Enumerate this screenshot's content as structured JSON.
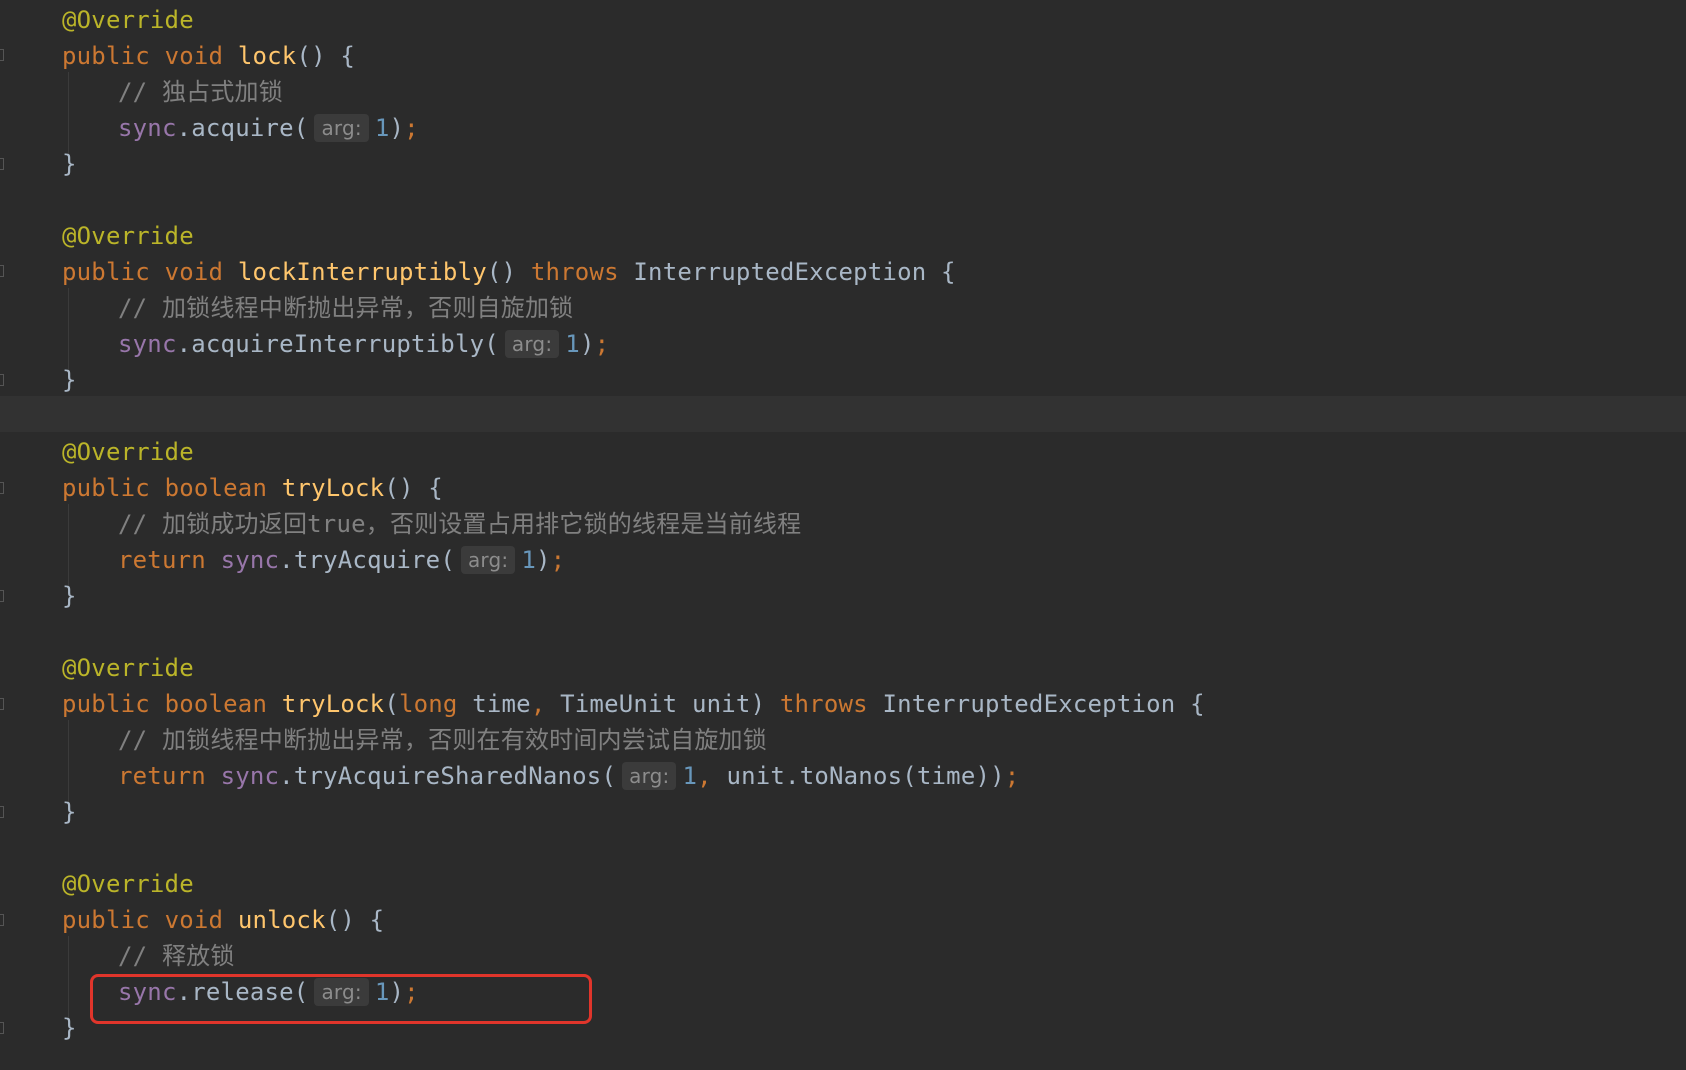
{
  "editor": {
    "methods": [
      {
        "annotation": "@Override",
        "signature": {
          "public": "public",
          "type": "void",
          "name": "lock",
          "params_open": "() {"
        },
        "comment": "// 独占式加锁",
        "body": {
          "field": "sync",
          "call": ".acquire(",
          "hint": "arg:",
          "arg": "1",
          "close": ")",
          "semi": ";"
        },
        "close": "}"
      },
      {
        "annotation": "@Override",
        "signature": {
          "public": "public",
          "type": "void",
          "name": "lockInterruptibly",
          "params_open": "() ",
          "throws": "throws",
          "exception": "InterruptedException {"
        },
        "comment": "// 加锁线程中断抛出异常，否则自旋加锁",
        "body": {
          "field": "sync",
          "call": ".acquireInterruptibly(",
          "hint": "arg:",
          "arg": "1",
          "close": ")",
          "semi": ";"
        },
        "close": "}"
      },
      {
        "annotation": "@Override",
        "signature": {
          "public": "public",
          "type": "boolean",
          "name": "tryLock",
          "params_open": "() {"
        },
        "comment": "// 加锁成功返回true，否则设置占用排它锁的线程是当前线程",
        "body": {
          "return": "return",
          "field": "sync",
          "call": ".tryAcquire(",
          "hint": "arg:",
          "arg": "1",
          "close": ")",
          "semi": ";"
        },
        "close": "}"
      },
      {
        "annotation": "@Override",
        "signature": {
          "public": "public",
          "type": "boolean",
          "name": "tryLock",
          "paren": "(",
          "p1_type": "long",
          "p1_name": " time",
          "comma": ",",
          "p2": " TimeUnit unit) ",
          "throws": "throws",
          "exception": "InterruptedException {"
        },
        "comment": "// 加锁线程中断抛出异常，否则在有效时间内尝试自旋加锁",
        "body": {
          "return": "return",
          "field": "sync",
          "call": ".tryAcquireSharedNanos(",
          "hint": "arg:",
          "arg": "1",
          "comma": ",",
          "rest": " unit.toNanos(time))",
          "semi": ";"
        },
        "close": "}"
      },
      {
        "annotation": "@Override",
        "signature": {
          "public": "public",
          "type": "void",
          "name": "unlock",
          "params_open": "() {"
        },
        "comment": "// 释放锁",
        "body": {
          "field": "sync",
          "call": ".release(",
          "hint": "arg:",
          "arg": "1",
          "close": ")",
          "semi": ";"
        },
        "close": "}"
      }
    ],
    "colors": {
      "background": "#2b2b2b",
      "keyword": "#cc7832",
      "annotation": "#bbb529",
      "function": "#ffc66d",
      "field": "#9876aa",
      "number": "#6897bb",
      "comment": "#808080",
      "highlight_box": "#e0352b"
    }
  }
}
